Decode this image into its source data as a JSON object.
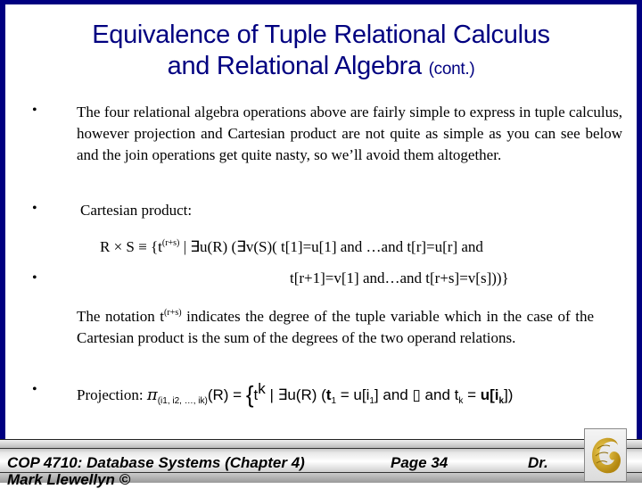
{
  "slide": {
    "title_line1": "Equivalence of Tuple Relational Calculus",
    "title_line2": "and Relational Algebra",
    "title_suffix": "(cont.)",
    "bullet_char": "•",
    "paragraph1": "The four relational algebra operations above are fairly simple to express in tuple calculus, however projection and Cartesian product are not quite as simple as you can see below and the join operations get quite nasty, so we’ll avoid them altogether.",
    "cartesian_label": "Cartesian product:",
    "cartesian_formula_line1_pre": "R × S ≡ {t",
    "cartesian_formula_sup": "(r+s)",
    "cartesian_formula_line1_post": " | ∃u(R) (∃v(S)( t[1]=u[1] and …and t[r]=u[r] and",
    "cartesian_formula_line2": "t[r+1]=v[1] and…and t[r+s]=v[s]))}",
    "notation_pre": "The notation t",
    "notation_sup": "(r+s)",
    "notation_post": " indicates the degree of the tuple variable which in the case of the Cartesian product is the sum of the degrees of the two operand relations.",
    "projection_label": "Projection:",
    "projection_formula": {
      "pi": "π",
      "pi_sub": "(i1, i2, …, ik)",
      "rel": "(R) = ",
      "brace": "{",
      "t": "t",
      "t_sup": "k",
      "mid": " | ∃u(R) (",
      "t1": "t",
      "t1_sub": "1",
      "eq1": " = u[i",
      "i1_sub": "1",
      "and_dots": "] and ▯   and t",
      "tk_sub": "k",
      "eq2": " = ",
      "u_ik": "u[i",
      "ik_sub": "k",
      "close": "])"
    }
  },
  "footer": {
    "course": "COP 4710: Database Systems  (Chapter 4)",
    "page": "Page 34",
    "author_prefix": "Dr.",
    "author_continued": "Mark Llewellyn ©",
    "logo": "ucf-pegasus-logo"
  },
  "colors": {
    "border": "#000080",
    "title": "#000080",
    "logo_gold": "#c9a21a"
  }
}
